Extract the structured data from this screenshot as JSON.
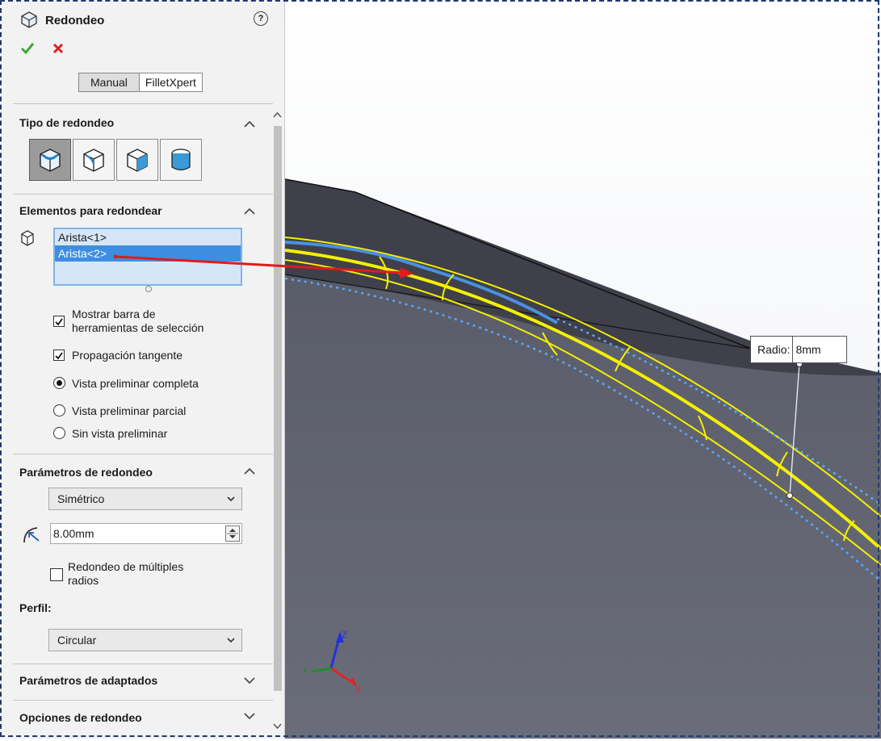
{
  "panel": {
    "title": "Redondeo",
    "help_glyph": "?",
    "ok_icon": "check-icon",
    "cancel_icon": "close-icon",
    "mode_tabs": [
      "Manual",
      "FilletXpert"
    ],
    "active_mode": "Manual"
  },
  "sections": {
    "tipo": {
      "title": "Tipo de redondeo",
      "types": [
        "constant-size-fillet-icon",
        "variable-size-fillet-icon",
        "face-fillet-icon",
        "full-round-fillet-icon"
      ],
      "selected_index": 0
    },
    "elementos": {
      "title": "Elementos para redondear",
      "items": [
        "Arista<1>",
        "Arista<2>"
      ],
      "selected_item": "Arista<2>",
      "options": {
        "mostrar_barra_line1": "Mostrar barra de",
        "mostrar_barra_line2": "herramientas de selección",
        "propagacion": "Propagación tangente",
        "vista_completa": "Vista preliminar completa",
        "vista_parcial": "Vista preliminar parcial",
        "sin_vista": "Sin vista preliminar"
      },
      "checked": {
        "mostrar_barra": true,
        "propagacion": true
      },
      "preview_mode": "Vista preliminar completa"
    },
    "parametros": {
      "title": "Parámetros de redondeo",
      "method": "Simétrico",
      "radius": "8.00mm",
      "multi_line1": "Redondeo de múltiples",
      "multi_line2": "radios",
      "multi_checked": false,
      "perfil_label": "Perfil:",
      "perfil": "Circular"
    },
    "adaptados": {
      "title": "Parámetros de adaptados"
    },
    "opciones": {
      "title": "Opciones de redondeo"
    }
  },
  "viewport": {
    "callout_label": "Radio:",
    "callout_value": "8mm",
    "triad": {
      "x": "X",
      "y": "Y",
      "z": "Z"
    },
    "colors": {
      "edge_highlight": "#f5f000",
      "edge_selected": "#4a90e2",
      "body": "#5f6270",
      "background": "#ffffff",
      "arrow": "#e01b1b"
    }
  }
}
